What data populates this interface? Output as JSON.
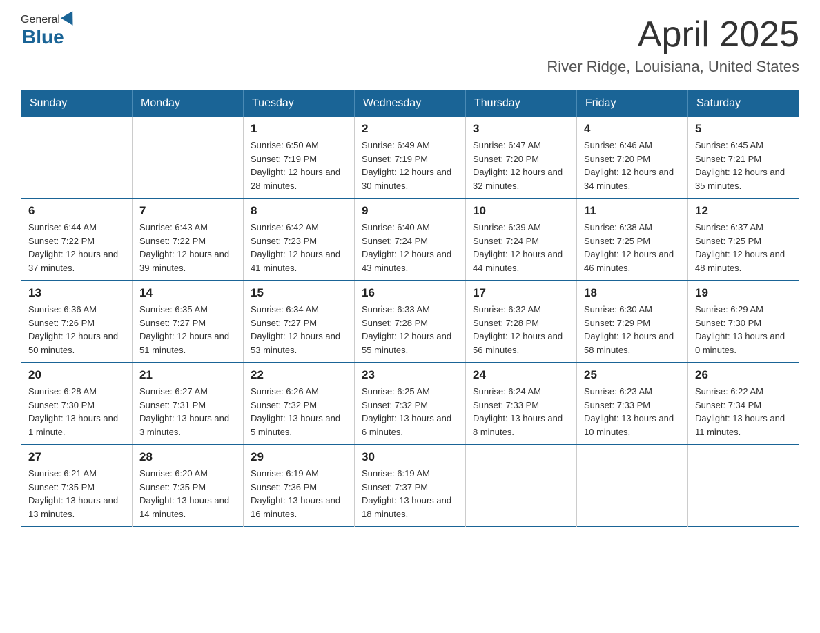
{
  "header": {
    "logo_general": "General",
    "logo_blue": "Blue",
    "month_title": "April 2025",
    "location": "River Ridge, Louisiana, United States"
  },
  "weekdays": [
    "Sunday",
    "Monday",
    "Tuesday",
    "Wednesday",
    "Thursday",
    "Friday",
    "Saturday"
  ],
  "weeks": [
    [
      {
        "day": "",
        "sunrise": "",
        "sunset": "",
        "daylight": ""
      },
      {
        "day": "",
        "sunrise": "",
        "sunset": "",
        "daylight": ""
      },
      {
        "day": "1",
        "sunrise": "Sunrise: 6:50 AM",
        "sunset": "Sunset: 7:19 PM",
        "daylight": "Daylight: 12 hours and 28 minutes."
      },
      {
        "day": "2",
        "sunrise": "Sunrise: 6:49 AM",
        "sunset": "Sunset: 7:19 PM",
        "daylight": "Daylight: 12 hours and 30 minutes."
      },
      {
        "day": "3",
        "sunrise": "Sunrise: 6:47 AM",
        "sunset": "Sunset: 7:20 PM",
        "daylight": "Daylight: 12 hours and 32 minutes."
      },
      {
        "day": "4",
        "sunrise": "Sunrise: 6:46 AM",
        "sunset": "Sunset: 7:20 PM",
        "daylight": "Daylight: 12 hours and 34 minutes."
      },
      {
        "day": "5",
        "sunrise": "Sunrise: 6:45 AM",
        "sunset": "Sunset: 7:21 PM",
        "daylight": "Daylight: 12 hours and 35 minutes."
      }
    ],
    [
      {
        "day": "6",
        "sunrise": "Sunrise: 6:44 AM",
        "sunset": "Sunset: 7:22 PM",
        "daylight": "Daylight: 12 hours and 37 minutes."
      },
      {
        "day": "7",
        "sunrise": "Sunrise: 6:43 AM",
        "sunset": "Sunset: 7:22 PM",
        "daylight": "Daylight: 12 hours and 39 minutes."
      },
      {
        "day": "8",
        "sunrise": "Sunrise: 6:42 AM",
        "sunset": "Sunset: 7:23 PM",
        "daylight": "Daylight: 12 hours and 41 minutes."
      },
      {
        "day": "9",
        "sunrise": "Sunrise: 6:40 AM",
        "sunset": "Sunset: 7:24 PM",
        "daylight": "Daylight: 12 hours and 43 minutes."
      },
      {
        "day": "10",
        "sunrise": "Sunrise: 6:39 AM",
        "sunset": "Sunset: 7:24 PM",
        "daylight": "Daylight: 12 hours and 44 minutes."
      },
      {
        "day": "11",
        "sunrise": "Sunrise: 6:38 AM",
        "sunset": "Sunset: 7:25 PM",
        "daylight": "Daylight: 12 hours and 46 minutes."
      },
      {
        "day": "12",
        "sunrise": "Sunrise: 6:37 AM",
        "sunset": "Sunset: 7:25 PM",
        "daylight": "Daylight: 12 hours and 48 minutes."
      }
    ],
    [
      {
        "day": "13",
        "sunrise": "Sunrise: 6:36 AM",
        "sunset": "Sunset: 7:26 PM",
        "daylight": "Daylight: 12 hours and 50 minutes."
      },
      {
        "day": "14",
        "sunrise": "Sunrise: 6:35 AM",
        "sunset": "Sunset: 7:27 PM",
        "daylight": "Daylight: 12 hours and 51 minutes."
      },
      {
        "day": "15",
        "sunrise": "Sunrise: 6:34 AM",
        "sunset": "Sunset: 7:27 PM",
        "daylight": "Daylight: 12 hours and 53 minutes."
      },
      {
        "day": "16",
        "sunrise": "Sunrise: 6:33 AM",
        "sunset": "Sunset: 7:28 PM",
        "daylight": "Daylight: 12 hours and 55 minutes."
      },
      {
        "day": "17",
        "sunrise": "Sunrise: 6:32 AM",
        "sunset": "Sunset: 7:28 PM",
        "daylight": "Daylight: 12 hours and 56 minutes."
      },
      {
        "day": "18",
        "sunrise": "Sunrise: 6:30 AM",
        "sunset": "Sunset: 7:29 PM",
        "daylight": "Daylight: 12 hours and 58 minutes."
      },
      {
        "day": "19",
        "sunrise": "Sunrise: 6:29 AM",
        "sunset": "Sunset: 7:30 PM",
        "daylight": "Daylight: 13 hours and 0 minutes."
      }
    ],
    [
      {
        "day": "20",
        "sunrise": "Sunrise: 6:28 AM",
        "sunset": "Sunset: 7:30 PM",
        "daylight": "Daylight: 13 hours and 1 minute."
      },
      {
        "day": "21",
        "sunrise": "Sunrise: 6:27 AM",
        "sunset": "Sunset: 7:31 PM",
        "daylight": "Daylight: 13 hours and 3 minutes."
      },
      {
        "day": "22",
        "sunrise": "Sunrise: 6:26 AM",
        "sunset": "Sunset: 7:32 PM",
        "daylight": "Daylight: 13 hours and 5 minutes."
      },
      {
        "day": "23",
        "sunrise": "Sunrise: 6:25 AM",
        "sunset": "Sunset: 7:32 PM",
        "daylight": "Daylight: 13 hours and 6 minutes."
      },
      {
        "day": "24",
        "sunrise": "Sunrise: 6:24 AM",
        "sunset": "Sunset: 7:33 PM",
        "daylight": "Daylight: 13 hours and 8 minutes."
      },
      {
        "day": "25",
        "sunrise": "Sunrise: 6:23 AM",
        "sunset": "Sunset: 7:33 PM",
        "daylight": "Daylight: 13 hours and 10 minutes."
      },
      {
        "day": "26",
        "sunrise": "Sunrise: 6:22 AM",
        "sunset": "Sunset: 7:34 PM",
        "daylight": "Daylight: 13 hours and 11 minutes."
      }
    ],
    [
      {
        "day": "27",
        "sunrise": "Sunrise: 6:21 AM",
        "sunset": "Sunset: 7:35 PM",
        "daylight": "Daylight: 13 hours and 13 minutes."
      },
      {
        "day": "28",
        "sunrise": "Sunrise: 6:20 AM",
        "sunset": "Sunset: 7:35 PM",
        "daylight": "Daylight: 13 hours and 14 minutes."
      },
      {
        "day": "29",
        "sunrise": "Sunrise: 6:19 AM",
        "sunset": "Sunset: 7:36 PM",
        "daylight": "Daylight: 13 hours and 16 minutes."
      },
      {
        "day": "30",
        "sunrise": "Sunrise: 6:19 AM",
        "sunset": "Sunset: 7:37 PM",
        "daylight": "Daylight: 13 hours and 18 minutes."
      },
      {
        "day": "",
        "sunrise": "",
        "sunset": "",
        "daylight": ""
      },
      {
        "day": "",
        "sunrise": "",
        "sunset": "",
        "daylight": ""
      },
      {
        "day": "",
        "sunrise": "",
        "sunset": "",
        "daylight": ""
      }
    ]
  ]
}
